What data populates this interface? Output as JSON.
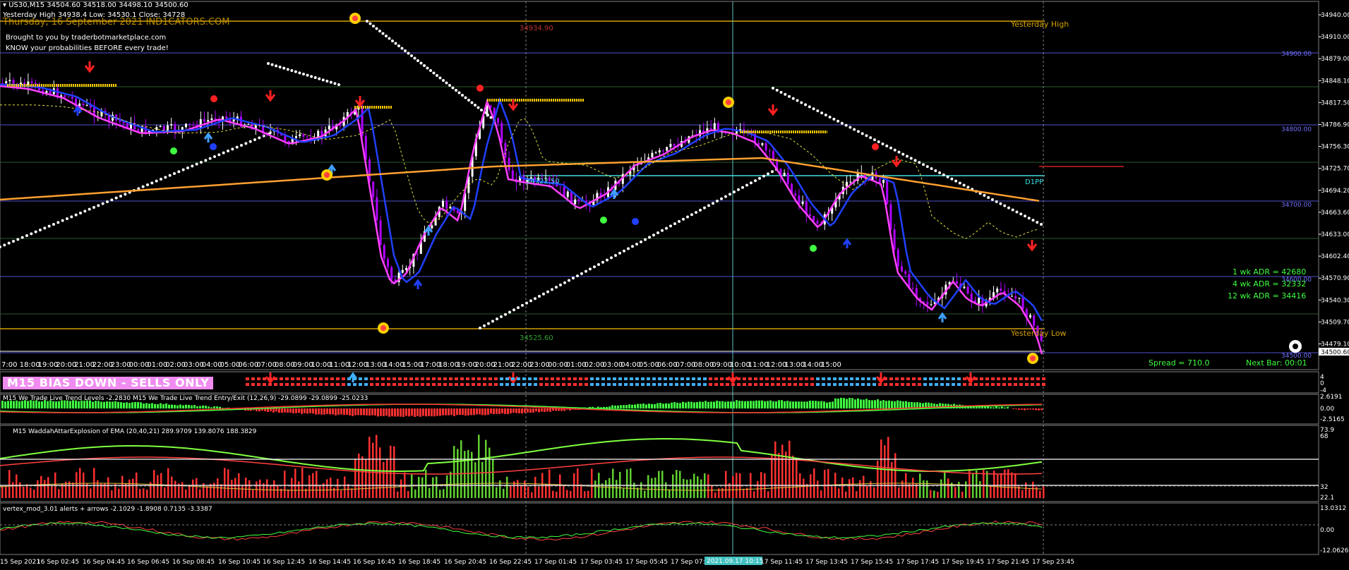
{
  "header": {
    "symbol_line": "US30,M15  34504.60 34518.00 34498.10 34500.60",
    "yesterday_line": "Yesterday High 34938.4   Low: 34530.1   Close: 34728",
    "overlay_line": "Thursday, 16 September 2021 IND1CATORS.COM",
    "brought_by": "Brought to you by traderbotmarketplace.com",
    "tagline": "KNOW your probabilities BEFORE every trade!"
  },
  "labels": {
    "yesterday_high": "Yesterday High",
    "yesterday_low": "Yesterday Low",
    "level_high": "34934.90",
    "level_low": "34525.60",
    "d1pp": "D1PP",
    "level_pp": "34722.50",
    "level_r1": "34900.00",
    "level_s1": "34800.00",
    "level_s2": "34700.00",
    "level_s3": "34600.00",
    "level_s4": "34500.00",
    "adr_1wk": "1 wk ADR =  42680",
    "adr_4wk": "4 wk ADR =  32332",
    "adr_12wk": "12 wk ADR =  34416",
    "spread": "Spread = 710.0",
    "next_bar": "Next Bar:  00:01",
    "bias": "M15  BIAS DOWN - SELLS ONLY",
    "price_tag": "34500.60"
  },
  "price_axis": [
    "34940.00",
    "34910.00",
    "34879.00",
    "34848.10",
    "34817.50",
    "34786.90",
    "34756.30",
    "34725.70",
    "34694.20",
    "34663.60",
    "34633.00",
    "34602.40",
    "34570.90",
    "34540.30",
    "34509.70",
    "34479.10"
  ],
  "time_axis": [
    "7:00",
    "18:00",
    "19:00",
    "20:00",
    "21:00",
    "22:00",
    "23:00",
    "00:00",
    "01:00",
    "02:00",
    "03:00",
    "04:00",
    "05:00",
    "06:00",
    "07:00",
    "08:00",
    "09:00",
    "10:00",
    "11:00",
    "12:00",
    "13:00",
    "14:00",
    "15:00",
    "17:00",
    "18:00",
    "19:00",
    "20:00",
    "21:00",
    "22:00",
    "23:00",
    "00:00",
    "01:00",
    "02:00",
    "03:00",
    "04:00",
    "05:00",
    "06:00",
    "07:00",
    "08:00",
    "09:00",
    "10:00",
    "11:00",
    "12:00",
    "13:00",
    "14:00",
    "15:00"
  ],
  "date_axis": [
    "15 Sep 2021",
    "16 Sep 02:45",
    "16 Sep 04:45",
    "16 Sep 06:45",
    "16 Sep 08:45",
    "16 Sep 10:45",
    "16 Sep 12:45",
    "16 Sep 14:45",
    "16 Sep 16:45",
    "16 Sep 18:45",
    "16 Sep 20:45",
    "16 Sep 22:45",
    "17 Sep 01:45",
    "17 Sep 03:45",
    "17 Sep 05:45",
    "17 Sep 07:45",
    "17 Sep 11:45",
    "17 Sep 13:45",
    "17 Sep 15:45",
    "17 Sep 17:45",
    "17 Sep 19:45",
    "17 Sep 21:45",
    "17 Sep 23:45"
  ],
  "crosshair_date": "2021.09.17 10:15",
  "panes": {
    "bias_axis": [
      "4",
      "0",
      "-4"
    ],
    "trend_title": "M15 We Trade Live Trend Levels -2.2830  M15 We Trade Live Trend Entry/Exit (12,26,9) -29.0899 -29.0899 -25.0233",
    "trend_axis": [
      "2.6191",
      "0.00",
      "-2.5165"
    ],
    "waddah_title": "M15  WaddahAttarExplosion of EMA (20,40,21) 289.9709 139.8076 188.3829",
    "waddah_axis": [
      "73.9",
      "68",
      "32",
      "22.1"
    ],
    "vertex_title": "vertex_mod_3.01 alerts + arrows -2.1029 -1.8908 0.7135 -3.3387",
    "vertex_axis": [
      "13.0312",
      "0.00",
      "-12.0626"
    ]
  },
  "colors": {
    "background": "#000000",
    "bull_candle": "#ffffff",
    "bear_candle": "#c000ff",
    "ma_fast": "#ff40ff",
    "ma_slow": "#2040ff",
    "ma_long": "#ffa030",
    "yesterday_line": "#d4a000",
    "level_line": "#7070ff",
    "pp_line": "#40e0e0",
    "arrow_down": "#ff2020",
    "arrow_up": "#40a0ff",
    "green_label": "#40ff40",
    "bias_bg": "#f08cf0"
  }
}
